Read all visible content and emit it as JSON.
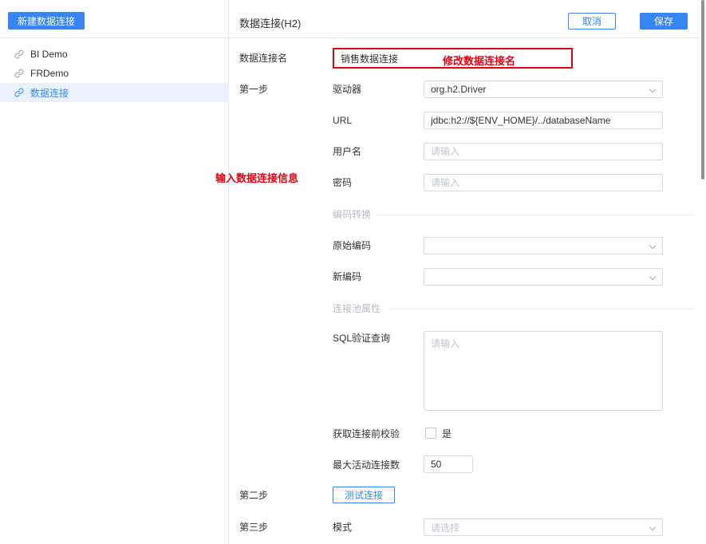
{
  "colors": {
    "primary": "#3685F2",
    "annotation_red": "#E60012",
    "selected_bg": "#E9F2FE"
  },
  "sidebar": {
    "new_button": "新建数据连接",
    "items": [
      {
        "label": "BI Demo",
        "selected": false
      },
      {
        "label": "FRDemo",
        "selected": false
      },
      {
        "label": "数据连接",
        "selected": true
      }
    ]
  },
  "header": {
    "title": "数据连接(H2)",
    "cancel": "取消",
    "save": "保存"
  },
  "annotations": {
    "rename_note": "修改数据连接名",
    "input_info_note": "输入数据连接信息"
  },
  "form": {
    "connection_name": {
      "label": "数据连接名",
      "value": "销售数据连接"
    },
    "steps": {
      "one": "第一步",
      "two": "第二步",
      "three": "第三步"
    },
    "driver": {
      "label": "驱动器",
      "value": "org.h2.Driver"
    },
    "url": {
      "label": "URL",
      "value": "jdbc:h2://${ENV_HOME}/../databaseName"
    },
    "username": {
      "label": "用户名",
      "placeholder": "请输入"
    },
    "password": {
      "label": "密码",
      "placeholder": "请输入"
    },
    "sections": {
      "encoding": "编码转换",
      "pool": "连接池属性"
    },
    "original_encoding": {
      "label": "原始编码"
    },
    "new_encoding": {
      "label": "新编码"
    },
    "sql_check": {
      "label": "SQL验证查询",
      "placeholder": "请输入"
    },
    "pre_check": {
      "label": "获取连接前校验",
      "option": "是"
    },
    "max_active": {
      "label": "最大活动连接数",
      "value": "50"
    },
    "test_button": "测试连接",
    "schema": {
      "label": "模式",
      "placeholder": "请选择"
    }
  }
}
